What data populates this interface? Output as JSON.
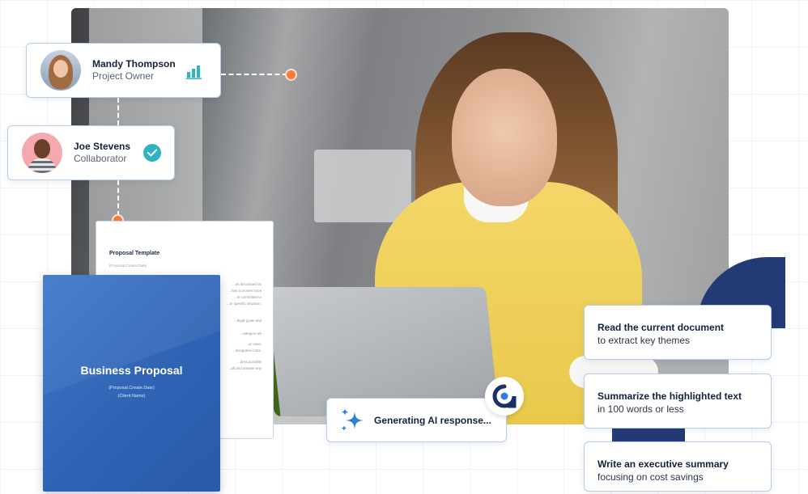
{
  "collaborators": [
    {
      "name": "Mandy Thompson",
      "role": "Project Owner",
      "icon": "bar-chart-icon"
    },
    {
      "name": "Joe Stevens",
      "role": "Collaborator",
      "icon": "check-circle-icon"
    }
  ],
  "template_doc": {
    "title": "Proposal Template",
    "subtitle": "(Proposal.Create.Date)",
    "body_lines": [
      "...as discussed on",
      "...has a proven track",
      "...is committed to",
      "...ur specific situation.",
      "...legal goals and",
      "...rategies we",
      "...ur case,",
      "...nticipated costs.",
      "...best possible",
      "...all and answer any"
    ]
  },
  "cover": {
    "title": "Business Proposal",
    "date": "(Proposal.Create.Date)",
    "client": "(Client.Name)"
  },
  "ai_status": {
    "text": "Generating AI response...",
    "icon": "sparkle-icon"
  },
  "prompts": [
    {
      "title": "Read the current document",
      "subtitle": "to extract key themes"
    },
    {
      "title": "Summarize the highlighted text",
      "subtitle": "in 100 words or less"
    },
    {
      "title": "Write an executive summary",
      "subtitle": "focusing on cost savings"
    }
  ],
  "colors": {
    "accent_orange": "#f57c3c",
    "brand_navy": "#243a77",
    "teal": "#2fb3c0",
    "cover_blue": "#2e62b3"
  }
}
